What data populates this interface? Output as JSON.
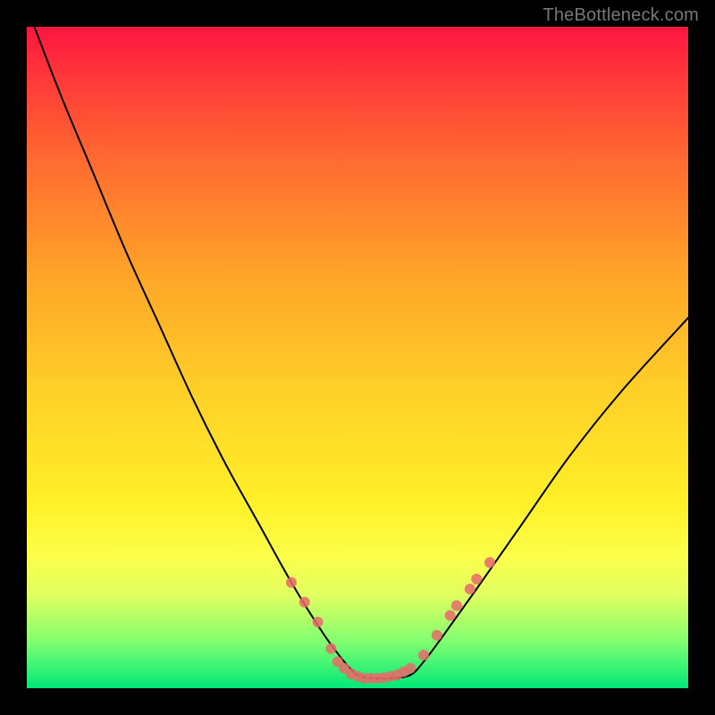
{
  "watermark": "TheBottleneck.com",
  "chart_data": {
    "type": "line",
    "title": "",
    "xlabel": "",
    "ylabel": "",
    "xlim": [
      0,
      100
    ],
    "ylim": [
      0,
      100
    ],
    "grid": false,
    "legend": false,
    "series": [
      {
        "name": "curve",
        "x": [
          0,
          5,
          10,
          15,
          20,
          25,
          30,
          35,
          40,
          45,
          48,
          50,
          52,
          55,
          58,
          60,
          63,
          68,
          75,
          82,
          90,
          100
        ],
        "y": [
          103,
          90,
          78,
          66,
          55,
          44,
          34,
          25,
          16,
          8,
          4,
          2,
          1.5,
          1.5,
          2,
          4,
          8,
          15,
          25,
          35,
          45,
          56
        ]
      }
    ],
    "markers": {
      "name": "flat-region-markers",
      "color": "#e86a6a",
      "radius_primary": 6,
      "radius_secondary": 4,
      "points": [
        {
          "x": 40,
          "y": 16
        },
        {
          "x": 42,
          "y": 13
        },
        {
          "x": 44,
          "y": 10
        },
        {
          "x": 46,
          "y": 6
        },
        {
          "x": 47,
          "y": 4
        },
        {
          "x": 48,
          "y": 3
        },
        {
          "x": 49,
          "y": 2.2
        },
        {
          "x": 50,
          "y": 1.8
        },
        {
          "x": 51,
          "y": 1.5
        },
        {
          "x": 52,
          "y": 1.5
        },
        {
          "x": 53,
          "y": 1.5
        },
        {
          "x": 54,
          "y": 1.6
        },
        {
          "x": 55,
          "y": 1.8
        },
        {
          "x": 56,
          "y": 2
        },
        {
          "x": 57,
          "y": 2.5
        },
        {
          "x": 58,
          "y": 3
        },
        {
          "x": 60,
          "y": 5
        },
        {
          "x": 62,
          "y": 8
        },
        {
          "x": 64,
          "y": 11
        },
        {
          "x": 65,
          "y": 12.5
        },
        {
          "x": 67,
          "y": 15
        },
        {
          "x": 68,
          "y": 16.5
        },
        {
          "x": 70,
          "y": 19
        }
      ]
    }
  }
}
